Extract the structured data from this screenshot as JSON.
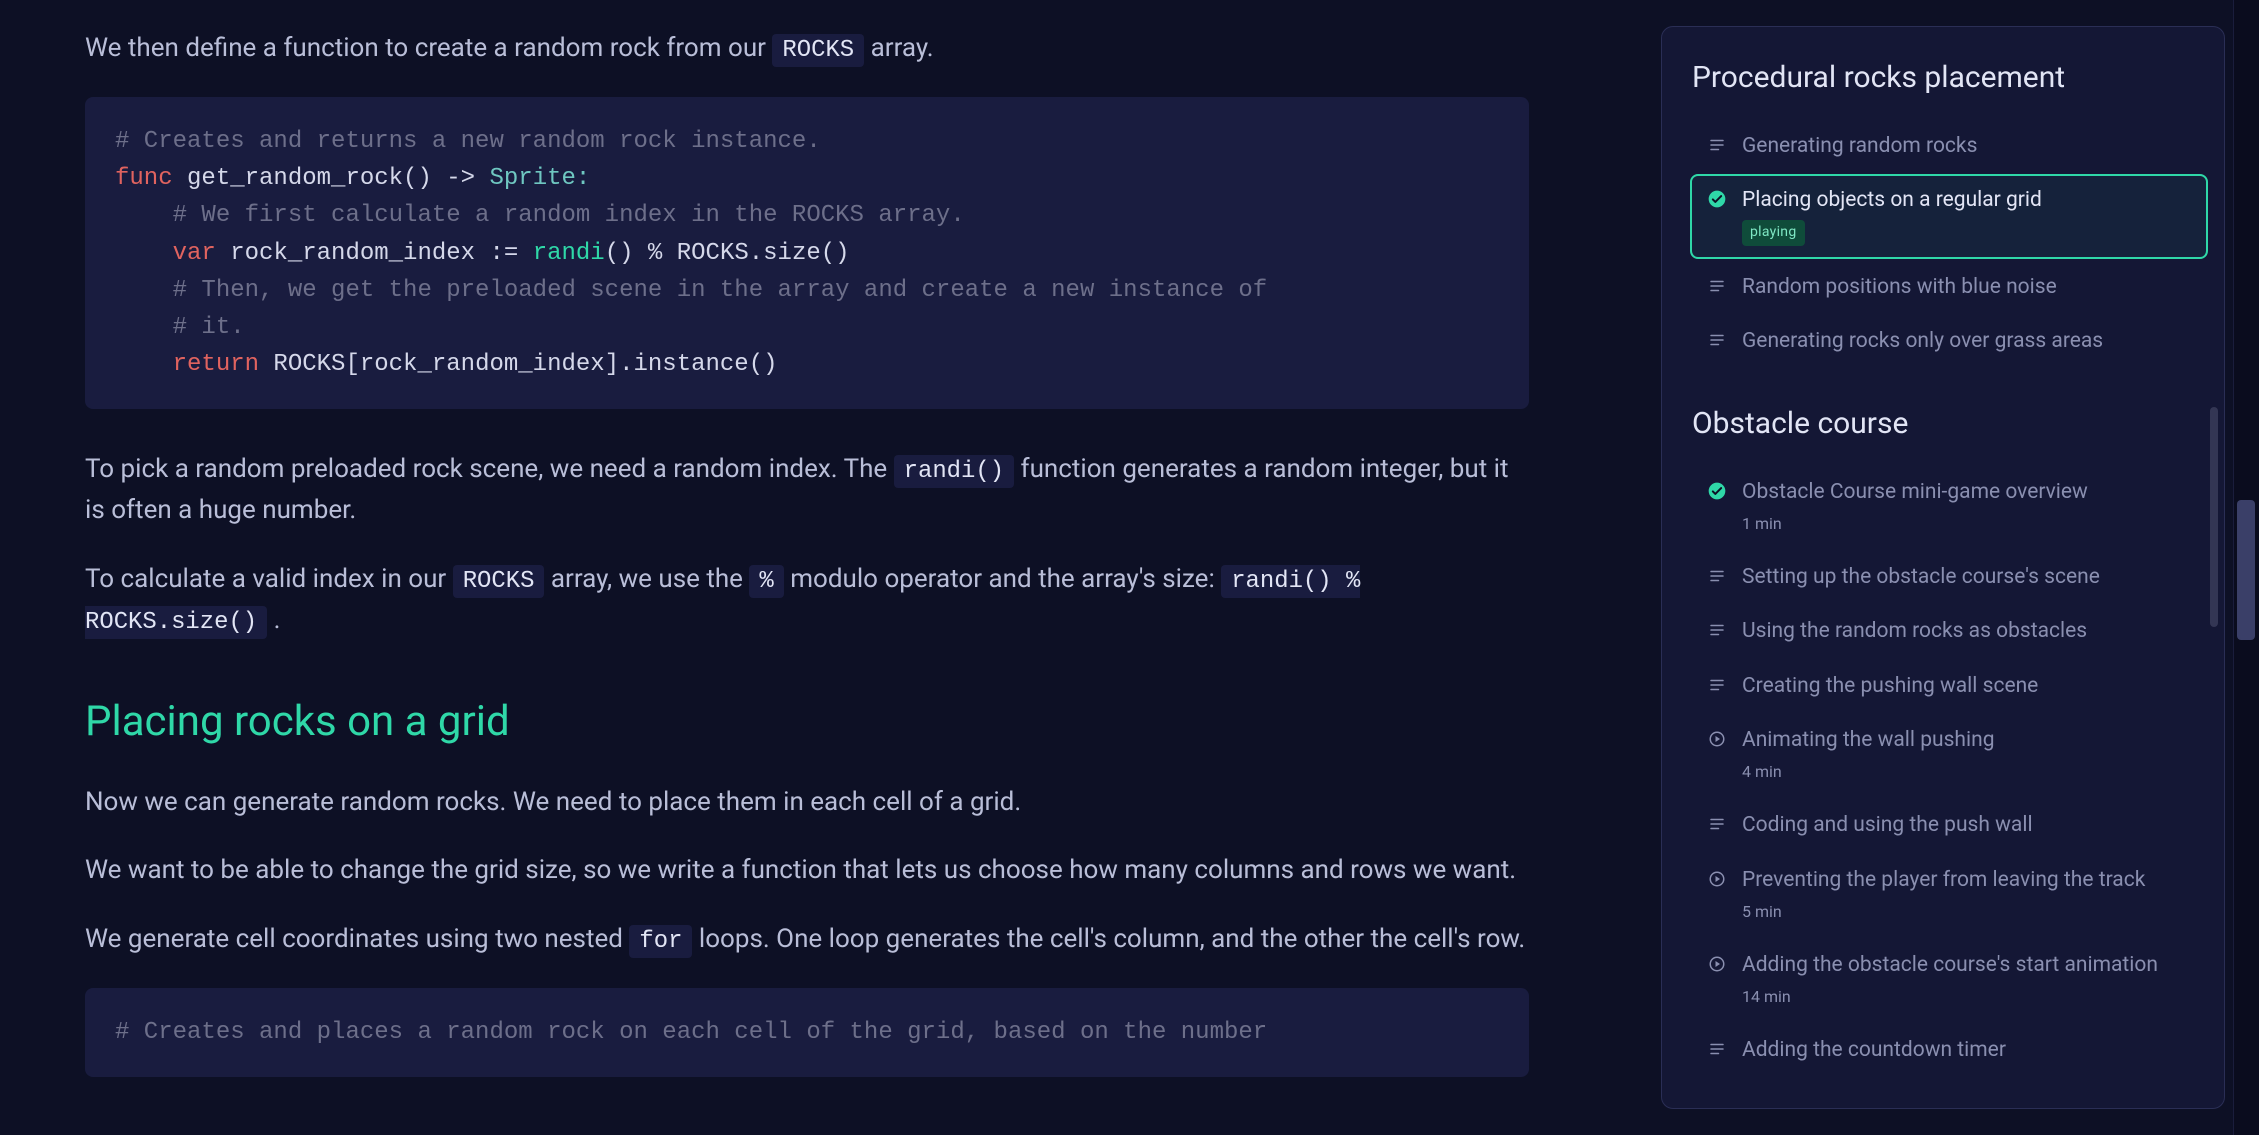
{
  "main": {
    "partial_top_prefix": "We then define a function to create a random rock from our ",
    "partial_top_code": "ROCKS",
    "partial_top_suffix": " array.",
    "code1": {
      "c1": "# Creates and returns a new random rock instance.",
      "l2_kw": "func",
      "l2_name": " get_random_rock() ",
      "l2_arrow": "->",
      "l2_type": " Sprite:",
      "c3": "    # We first calculate a random index in the ROCKS array.",
      "l4_kw": "    var",
      "l4_name": " rock_random_index ",
      "l4_op": ":=",
      "l4_call": " randi",
      "l4_rest": "() % ROCKS.size()",
      "c5": "    # Then, we get the preloaded scene in the array and create a new instance of",
      "c6": "    # it.",
      "l7_kw": "    return",
      "l7_rest": " ROCKS[rock_random_index].instance()"
    },
    "p2_prefix": "To pick a random preloaded rock scene, we need a random index. The ",
    "p2_code": "randi()",
    "p2_suffix": " function generates a random integer, but it is often a huge number.",
    "p3_prefix": "To calculate a valid index in our ",
    "p3_code1": "ROCKS",
    "p3_mid": " array, we use the ",
    "p3_code2": "%",
    "p3_suffix": " modulo operator and the array's size: ",
    "p3_code3": "randi() % ROCKS.size()",
    "p3_end": ".",
    "h2": "Placing rocks on a grid",
    "p4": "Now we can generate random rocks. We need to place them in each cell of a grid.",
    "p5": "We want to be able to change the grid size, so we write a function that lets us choose how many columns and rows we want.",
    "p6_prefix": "We generate cell coordinates using two nested ",
    "p6_code": "for",
    "p6_suffix": " loops. One loop generates the cell's column, and the other the cell's row.",
    "code2": {
      "c1": "# Creates and places a random rock on each cell of the grid, based on the number"
    }
  },
  "sidebar": {
    "groups": [
      {
        "title": "Procedural rocks placement",
        "items": [
          {
            "icon": "text",
            "label": "Generating random rocks",
            "interactable": true
          },
          {
            "icon": "check",
            "label": "Placing objects on a regular grid",
            "interactable": true,
            "active": true,
            "badge": "playing"
          },
          {
            "icon": "text",
            "label": "Random positions with blue noise",
            "interactable": true
          },
          {
            "icon": "text",
            "label": "Generating rocks only over grass areas",
            "interactable": true
          }
        ]
      },
      {
        "title": "Obstacle course",
        "items": [
          {
            "icon": "check",
            "label": "Obstacle Course mini-game overview",
            "meta": "1 min",
            "interactable": true
          },
          {
            "icon": "text",
            "label": "Setting up the obstacle course's scene",
            "interactable": true
          },
          {
            "icon": "text",
            "label": "Using the random rocks as obstacles",
            "interactable": true
          },
          {
            "icon": "text",
            "label": "Creating the pushing wall scene",
            "interactable": true
          },
          {
            "icon": "play",
            "label": "Animating the wall pushing",
            "meta": "4 min",
            "interactable": true
          },
          {
            "icon": "text",
            "label": "Coding and using the push wall",
            "interactable": true
          },
          {
            "icon": "play",
            "label": "Preventing the player from leaving the track",
            "meta": "5 min",
            "interactable": true
          },
          {
            "icon": "play",
            "label": "Adding the obstacle course's start animation",
            "meta": "14 min",
            "interactable": true
          },
          {
            "icon": "text",
            "label": "Adding the countdown timer",
            "interactable": true
          }
        ]
      }
    ]
  }
}
